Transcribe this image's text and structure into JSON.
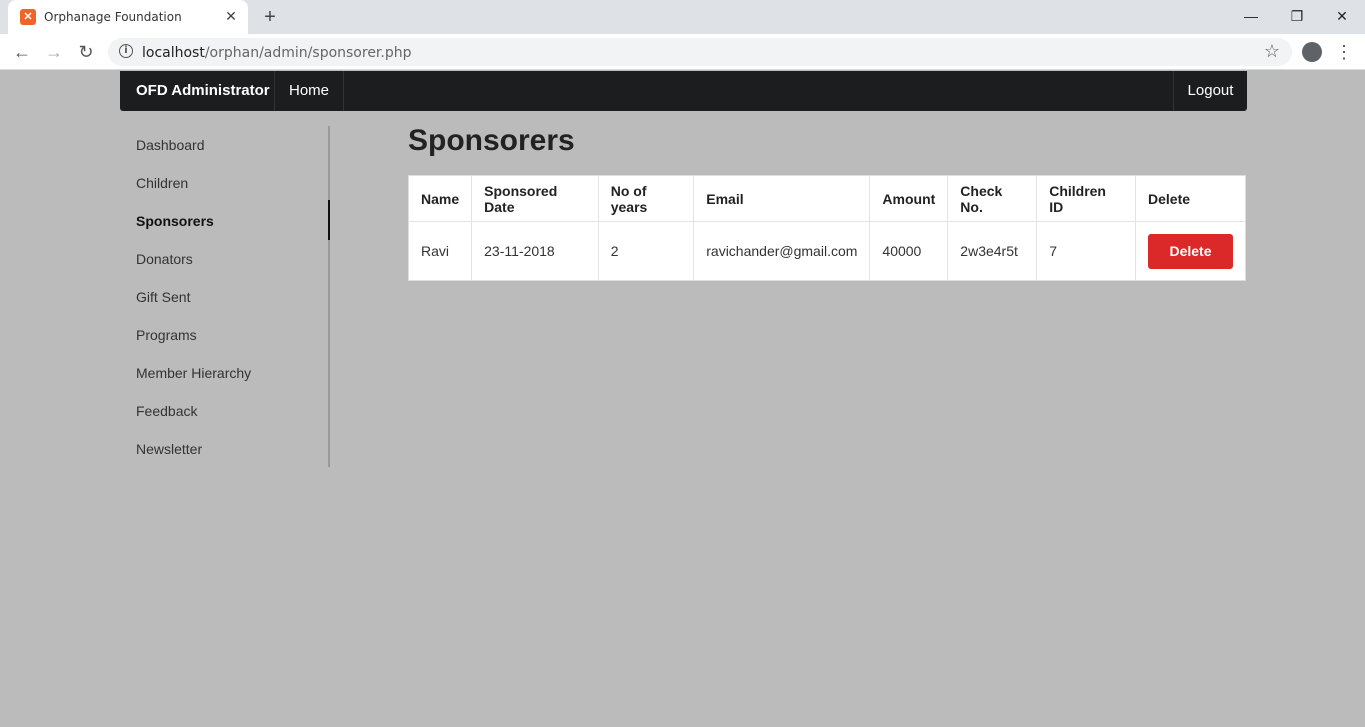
{
  "browser": {
    "tab_title": "Orphanage Foundation",
    "url_host": "localhost",
    "url_path": "/orphan/admin/sponsorer.php"
  },
  "navbar": {
    "brand": "OFD Administrator",
    "home": "Home",
    "logout": "Logout"
  },
  "sidebar": {
    "items": [
      {
        "label": "Dashboard"
      },
      {
        "label": "Children"
      },
      {
        "label": "Sponsorers"
      },
      {
        "label": "Donators"
      },
      {
        "label": "Gift Sent"
      },
      {
        "label": "Programs"
      },
      {
        "label": "Member Hierarchy"
      },
      {
        "label": "Feedback"
      },
      {
        "label": "Newsletter"
      }
    ],
    "active_index": 2
  },
  "main": {
    "title": "Sponsorers",
    "table": {
      "headers": [
        "Name",
        "Sponsored Date",
        "No of years",
        "Email",
        "Amount",
        "Check No.",
        "Children ID",
        "Delete"
      ],
      "rows": [
        {
          "name": "Ravi",
          "date": "23-11-2018",
          "years": "2",
          "email": "ravichander@gmail.com",
          "amount": "40000",
          "check": "2w3e4r5t",
          "children_id": "7",
          "action": "Delete"
        }
      ]
    }
  },
  "colors": {
    "navbar": "#1c1d1f",
    "page_bg": "#bbbbbb",
    "delete_button": "#db2828"
  }
}
